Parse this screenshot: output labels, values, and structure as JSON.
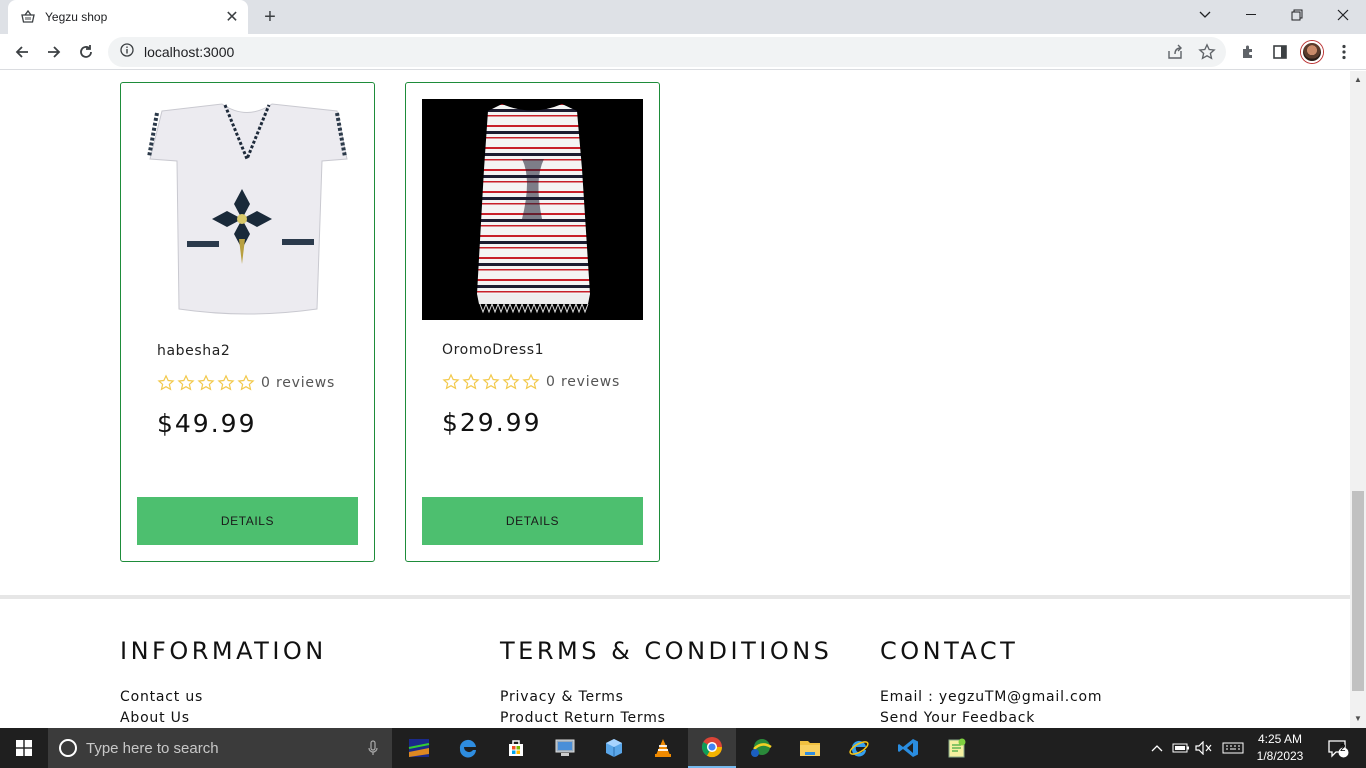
{
  "browser": {
    "tab_title": "Yegzu shop",
    "url": "localhost:3000"
  },
  "products": [
    {
      "name": "habesha2",
      "reviews": "0 reviews",
      "price": "$49.99",
      "button": "DETAILS",
      "rating": 0
    },
    {
      "name": "OromoDress1",
      "reviews": "0 reviews",
      "price": "$29.99",
      "button": "DETAILS",
      "rating": 0
    }
  ],
  "footer": {
    "information": {
      "title": "INFORMATION",
      "links": [
        "Contact us",
        "About Us"
      ]
    },
    "terms": {
      "title": "TERMS & CONDITIONS",
      "links": [
        "Privacy & Terms",
        "Product Return Terms"
      ]
    },
    "contact": {
      "title": "CONTACT",
      "links": [
        "Email : yegzuTM@gmail.com",
        "Send Your Feedback"
      ]
    }
  },
  "taskbar": {
    "search_placeholder": "Type here to search",
    "time": "4:25 AM",
    "date": "1/8/2023",
    "notifications": "2"
  },
  "colors": {
    "card_border": "#1e8c3a",
    "button_bg": "#4dbf6f",
    "star": "#f2c94c"
  }
}
